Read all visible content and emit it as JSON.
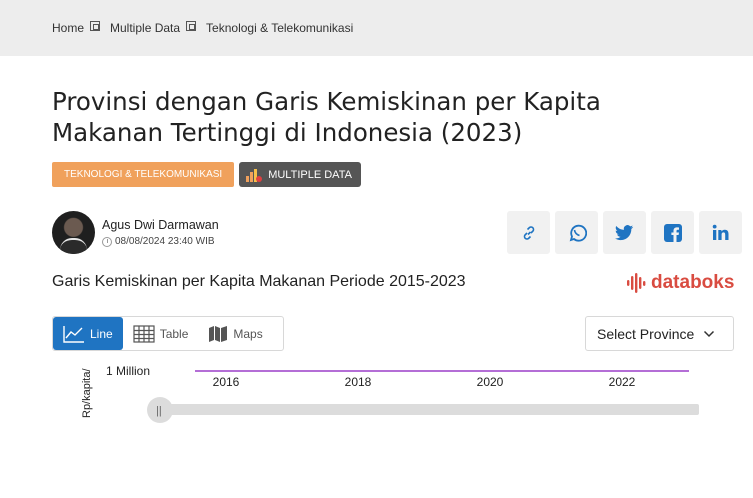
{
  "breadcrumb": {
    "home": "Home",
    "multiple": "Multiple Data",
    "category": "Teknologi & Telekomunikasi"
  },
  "article": {
    "title_line1": "Provinsi dengan Garis Kemiskinan per Kapita",
    "title_line2": "Makanan Tertinggi di Indonesia (2023)",
    "category_badge": "TEKNOLOGI & TELEKOMUNIKASI",
    "multi_badge": "MULTIPLE DATA",
    "author": "Agus Dwi Darmawan",
    "date": "08/08/2024 23:40 WIB"
  },
  "share": [
    "link-icon",
    "whatsapp-icon",
    "twitter-icon",
    "facebook-icon",
    "linkedin-icon"
  ],
  "chart_section": {
    "subtitle": "Garis Kemiskinan per Kapita Makanan Periode 2015-2023",
    "logo": "databoks",
    "tabs": [
      {
        "label": "Line"
      },
      {
        "label": "Table"
      },
      {
        "label": "Maps"
      }
    ],
    "select_label": "Select Province"
  },
  "colors": {
    "accent": "#1f74c2",
    "category": "#f0a15c",
    "line": "#9b3fc8",
    "logo": "#d94c41"
  },
  "chart_data": {
    "type": "line",
    "ylabel": "Rp/kapita/",
    "y_tick_label": "1 Million",
    "x_tick_labels": [
      "2016",
      "2018",
      "2020",
      "2022"
    ],
    "x_range": [
      2015,
      2023
    ],
    "slider_handle": "||"
  }
}
